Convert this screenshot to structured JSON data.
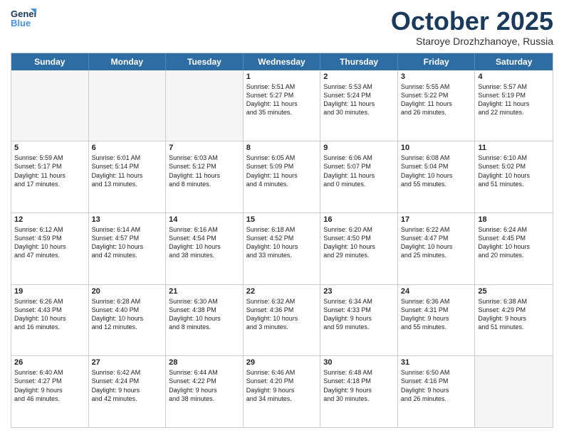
{
  "header": {
    "logo_line1": "General",
    "logo_line2": "Blue",
    "month_title": "October 2025",
    "location": "Staroye Drozhzhanoye, Russia"
  },
  "days_of_week": [
    "Sunday",
    "Monday",
    "Tuesday",
    "Wednesday",
    "Thursday",
    "Friday",
    "Saturday"
  ],
  "weeks": [
    [
      {
        "day": "",
        "text": "",
        "empty": true
      },
      {
        "day": "",
        "text": "",
        "empty": true
      },
      {
        "day": "",
        "text": "",
        "empty": true
      },
      {
        "day": "1",
        "text": "Sunrise: 5:51 AM\nSunset: 5:27 PM\nDaylight: 11 hours\nand 35 minutes.",
        "empty": false
      },
      {
        "day": "2",
        "text": "Sunrise: 5:53 AM\nSunset: 5:24 PM\nDaylight: 11 hours\nand 30 minutes.",
        "empty": false
      },
      {
        "day": "3",
        "text": "Sunrise: 5:55 AM\nSunset: 5:22 PM\nDaylight: 11 hours\nand 26 minutes.",
        "empty": false
      },
      {
        "day": "4",
        "text": "Sunrise: 5:57 AM\nSunset: 5:19 PM\nDaylight: 11 hours\nand 22 minutes.",
        "empty": false
      }
    ],
    [
      {
        "day": "5",
        "text": "Sunrise: 5:59 AM\nSunset: 5:17 PM\nDaylight: 11 hours\nand 17 minutes.",
        "empty": false
      },
      {
        "day": "6",
        "text": "Sunrise: 6:01 AM\nSunset: 5:14 PM\nDaylight: 11 hours\nand 13 minutes.",
        "empty": false
      },
      {
        "day": "7",
        "text": "Sunrise: 6:03 AM\nSunset: 5:12 PM\nDaylight: 11 hours\nand 8 minutes.",
        "empty": false
      },
      {
        "day": "8",
        "text": "Sunrise: 6:05 AM\nSunset: 5:09 PM\nDaylight: 11 hours\nand 4 minutes.",
        "empty": false
      },
      {
        "day": "9",
        "text": "Sunrise: 6:06 AM\nSunset: 5:07 PM\nDaylight: 11 hours\nand 0 minutes.",
        "empty": false
      },
      {
        "day": "10",
        "text": "Sunrise: 6:08 AM\nSunset: 5:04 PM\nDaylight: 10 hours\nand 55 minutes.",
        "empty": false
      },
      {
        "day": "11",
        "text": "Sunrise: 6:10 AM\nSunset: 5:02 PM\nDaylight: 10 hours\nand 51 minutes.",
        "empty": false
      }
    ],
    [
      {
        "day": "12",
        "text": "Sunrise: 6:12 AM\nSunset: 4:59 PM\nDaylight: 10 hours\nand 47 minutes.",
        "empty": false
      },
      {
        "day": "13",
        "text": "Sunrise: 6:14 AM\nSunset: 4:57 PM\nDaylight: 10 hours\nand 42 minutes.",
        "empty": false
      },
      {
        "day": "14",
        "text": "Sunrise: 6:16 AM\nSunset: 4:54 PM\nDaylight: 10 hours\nand 38 minutes.",
        "empty": false
      },
      {
        "day": "15",
        "text": "Sunrise: 6:18 AM\nSunset: 4:52 PM\nDaylight: 10 hours\nand 33 minutes.",
        "empty": false
      },
      {
        "day": "16",
        "text": "Sunrise: 6:20 AM\nSunset: 4:50 PM\nDaylight: 10 hours\nand 29 minutes.",
        "empty": false
      },
      {
        "day": "17",
        "text": "Sunrise: 6:22 AM\nSunset: 4:47 PM\nDaylight: 10 hours\nand 25 minutes.",
        "empty": false
      },
      {
        "day": "18",
        "text": "Sunrise: 6:24 AM\nSunset: 4:45 PM\nDaylight: 10 hours\nand 20 minutes.",
        "empty": false
      }
    ],
    [
      {
        "day": "19",
        "text": "Sunrise: 6:26 AM\nSunset: 4:43 PM\nDaylight: 10 hours\nand 16 minutes.",
        "empty": false
      },
      {
        "day": "20",
        "text": "Sunrise: 6:28 AM\nSunset: 4:40 PM\nDaylight: 10 hours\nand 12 minutes.",
        "empty": false
      },
      {
        "day": "21",
        "text": "Sunrise: 6:30 AM\nSunset: 4:38 PM\nDaylight: 10 hours\nand 8 minutes.",
        "empty": false
      },
      {
        "day": "22",
        "text": "Sunrise: 6:32 AM\nSunset: 4:36 PM\nDaylight: 10 hours\nand 3 minutes.",
        "empty": false
      },
      {
        "day": "23",
        "text": "Sunrise: 6:34 AM\nSunset: 4:33 PM\nDaylight: 9 hours\nand 59 minutes.",
        "empty": false
      },
      {
        "day": "24",
        "text": "Sunrise: 6:36 AM\nSunset: 4:31 PM\nDaylight: 9 hours\nand 55 minutes.",
        "empty": false
      },
      {
        "day": "25",
        "text": "Sunrise: 6:38 AM\nSunset: 4:29 PM\nDaylight: 9 hours\nand 51 minutes.",
        "empty": false
      }
    ],
    [
      {
        "day": "26",
        "text": "Sunrise: 6:40 AM\nSunset: 4:27 PM\nDaylight: 9 hours\nand 46 minutes.",
        "empty": false
      },
      {
        "day": "27",
        "text": "Sunrise: 6:42 AM\nSunset: 4:24 PM\nDaylight: 9 hours\nand 42 minutes.",
        "empty": false
      },
      {
        "day": "28",
        "text": "Sunrise: 6:44 AM\nSunset: 4:22 PM\nDaylight: 9 hours\nand 38 minutes.",
        "empty": false
      },
      {
        "day": "29",
        "text": "Sunrise: 6:46 AM\nSunset: 4:20 PM\nDaylight: 9 hours\nand 34 minutes.",
        "empty": false
      },
      {
        "day": "30",
        "text": "Sunrise: 6:48 AM\nSunset: 4:18 PM\nDaylight: 9 hours\nand 30 minutes.",
        "empty": false
      },
      {
        "day": "31",
        "text": "Sunrise: 6:50 AM\nSunset: 4:16 PM\nDaylight: 9 hours\nand 26 minutes.",
        "empty": false
      },
      {
        "day": "",
        "text": "",
        "empty": true
      }
    ]
  ]
}
